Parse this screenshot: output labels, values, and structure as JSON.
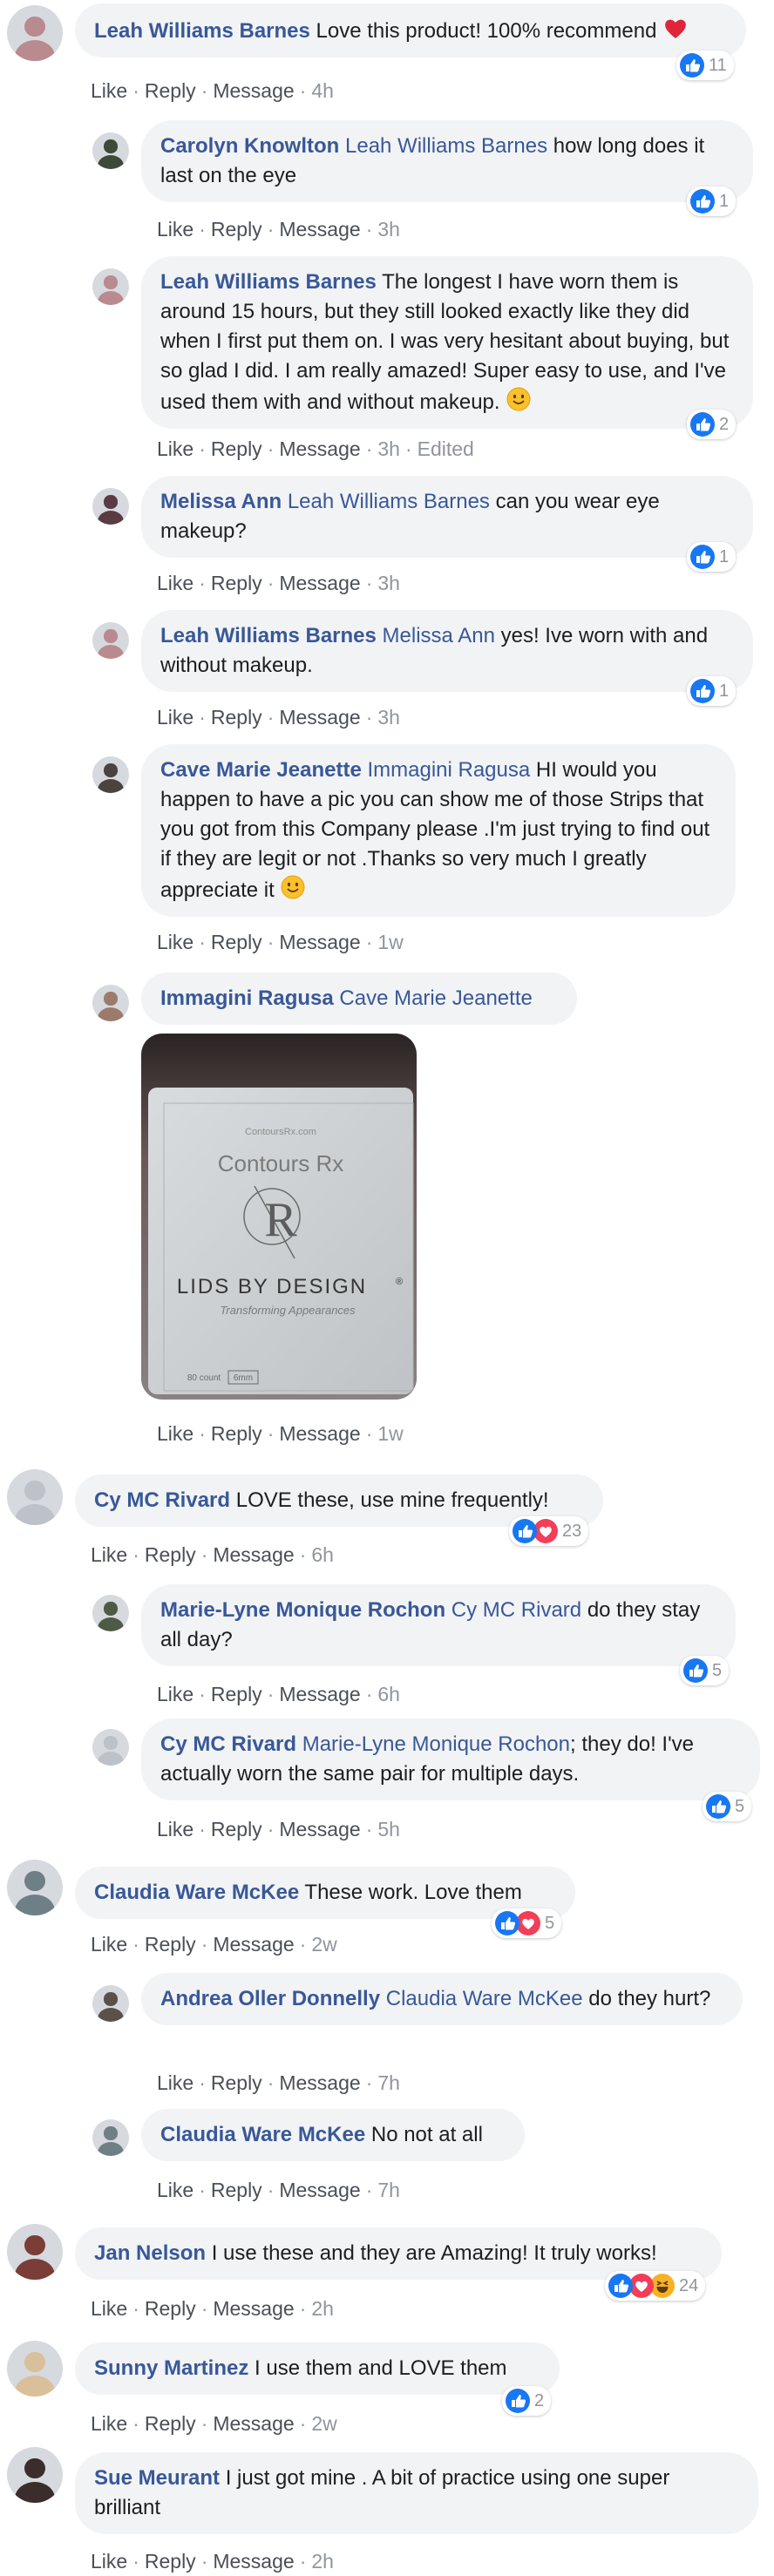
{
  "actions": {
    "like": "Like",
    "reply": "Reply",
    "message": "Message",
    "edited": "Edited"
  },
  "comments": [
    {
      "author": "Leah Williams Barnes",
      "mention": "",
      "text": "Love this product! 100% recommend",
      "trailing_emoji": "red-heart",
      "time": "4h",
      "reactions": [
        "like"
      ],
      "reaction_count": "11",
      "avatar_color": "#b98a8f"
    },
    {
      "author": "Carolyn Knowlton",
      "mention": "Leah Williams Barnes",
      "text": "how long does it last on the eye",
      "time": "3h",
      "reactions": [
        "like"
      ],
      "reaction_count": "1",
      "avatar_color": "#3d4a3a"
    },
    {
      "author": "Leah Williams Barnes",
      "mention": "",
      "text": "The longest I have worn them is around 15 hours, but they still looked exactly like they did when I first put them on. I was very hesitant about buying, but so glad I did. I am really amazed! Super easy to use, and I've used them with and without makeup.",
      "trailing_emoji": "smiling-face",
      "time": "3h",
      "edited": true,
      "reactions": [
        "like"
      ],
      "reaction_count": "2",
      "avatar_color": "#b98a8f"
    },
    {
      "author": "Melissa Ann",
      "mention": "Leah Williams Barnes",
      "text": "can you wear eye makeup?",
      "time": "3h",
      "reactions": [
        "like"
      ],
      "reaction_count": "1",
      "avatar_color": "#5a3b44"
    },
    {
      "author": "Leah Williams Barnes",
      "mention": "Melissa Ann",
      "text": "yes! Ive worn with and without makeup.",
      "time": "3h",
      "reactions": [
        "like"
      ],
      "reaction_count": "1",
      "avatar_color": "#b98a8f"
    },
    {
      "author": "Cave Marie Jeanette",
      "mention": "Immagini Ragusa",
      "text": "HI would you happen to have a pic you can show me of those Strips that you got from this Company please .I'm just trying to find out if they are legit or not .Thanks so very much I greatly appreciate it",
      "trailing_emoji": "smiling-face",
      "time": "1w",
      "reactions": [],
      "reaction_count": "",
      "avatar_color": "#4a4340"
    },
    {
      "author": "Immagini Ragusa",
      "mention": "Cave Marie Jeanette",
      "text": "",
      "time": "1w",
      "reactions": [],
      "reaction_count": "",
      "avatar_color": "#9c7b6b",
      "photo": {
        "brand_small": "ContoursRx.com",
        "brand": "Contours Rx",
        "monogram": "R",
        "title": "LIDS BY DESIGN",
        "trademark": "®",
        "tagline": "Transforming Appearances",
        "count": "80 count",
        "size": "6mm"
      }
    },
    {
      "author": "Cy MC Rivard",
      "mention": "",
      "text": "LOVE these, use mine frequently!",
      "time": "6h",
      "reactions": [
        "like",
        "love"
      ],
      "reaction_count": "23",
      "avatar_color": "#bcc2c7"
    },
    {
      "author": "Marie-Lyne Monique Rochon",
      "mention": "Cy MC Rivard",
      "text": "do they stay all day?",
      "time": "6h",
      "reactions": [
        "like"
      ],
      "reaction_count": "5",
      "avatar_color": "#4e5a45"
    },
    {
      "author": "Cy MC Rivard",
      "mention": "Marie-Lyne Monique Rochon",
      "text": "; they do! I've actually worn the same pair for multiple days.",
      "time": "5h",
      "reactions": [
        "like"
      ],
      "reaction_count": "5",
      "avatar_color": "#bcc2c7"
    },
    {
      "author": "Claudia Ware McKee",
      "mention": "",
      "text": "These work. Love them",
      "time": "2w",
      "reactions": [
        "like",
        "love"
      ],
      "reaction_count": "5",
      "avatar_color": "#6f7f86"
    },
    {
      "author": "Andrea Oller Donnelly",
      "mention": "Claudia Ware McKee",
      "text": "do they hurt?",
      "time": "7h",
      "reactions": [],
      "reaction_count": "",
      "avatar_color": "#5a5248"
    },
    {
      "author": "Claudia Ware McKee",
      "mention": "",
      "text": "No not at all",
      "time": "7h",
      "reactions": [],
      "reaction_count": "",
      "avatar_color": "#6f7f86"
    },
    {
      "author": "Jan Nelson",
      "mention": "",
      "text": "I use these and they are Amazing! It truly works!",
      "time": "2h",
      "reactions": [
        "like",
        "love",
        "haha"
      ],
      "reaction_count": "24",
      "avatar_color": "#7a3d38"
    },
    {
      "author": "Sunny Martinez",
      "mention": "",
      "text": "I use them and LOVE them",
      "time": "2w",
      "reactions": [
        "like"
      ],
      "reaction_count": "2",
      "avatar_color": "#d9c09a"
    },
    {
      "author": "Sue Meurant",
      "mention": "",
      "text": "I just got mine . A bit of practice using one super brilliant",
      "time": "2h",
      "reactions": [],
      "reaction_count": "",
      "avatar_color": "#3a2d2b"
    }
  ],
  "icons": {
    "like": "like-reaction-icon",
    "love": "love-reaction-icon",
    "haha": "haha-reaction-icon",
    "red-heart": "red-heart-emoji-icon",
    "smiling-face": "smiling-face-emoji-icon"
  },
  "colors": {
    "author": "#385898",
    "bubble": "#f2f3f5",
    "like_blue": "#1877f2",
    "love_red": "#f33e58",
    "haha_yellow": "#f7b125"
  }
}
